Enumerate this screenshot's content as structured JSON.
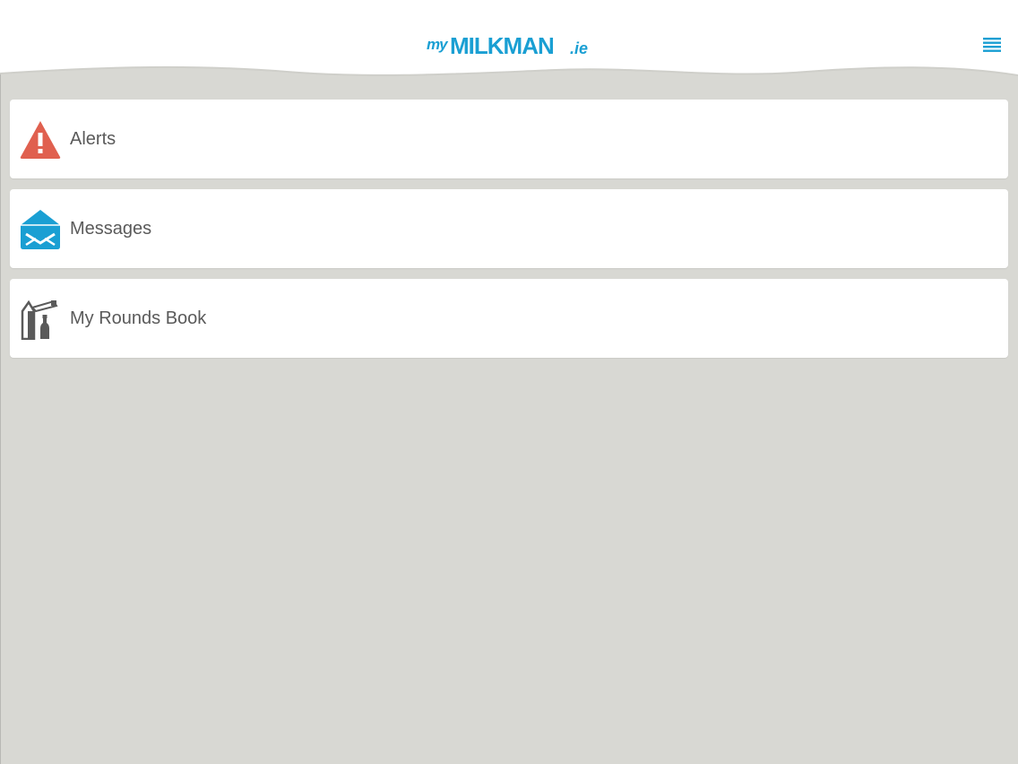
{
  "header": {
    "logo": {
      "prefix": "my",
      "main": "MILKMAN",
      "suffix": ".ie"
    },
    "menu_icon": "hamburger-menu-icon"
  },
  "menu": {
    "items": [
      {
        "label": "Alerts",
        "icon": "warning-triangle-icon",
        "icon_color": "#e0604f"
      },
      {
        "label": "Messages",
        "icon": "envelope-icon",
        "icon_color": "#1a9fd3"
      },
      {
        "label": "My Rounds Book",
        "icon": "milk-carton-bottle-icon",
        "icon_color": "#5a5a5a"
      }
    ]
  },
  "colors": {
    "brand": "#1a9fd3",
    "background": "#d8d8d3",
    "card": "#ffffff",
    "alert": "#e0604f",
    "text": "#5a5a5a"
  }
}
